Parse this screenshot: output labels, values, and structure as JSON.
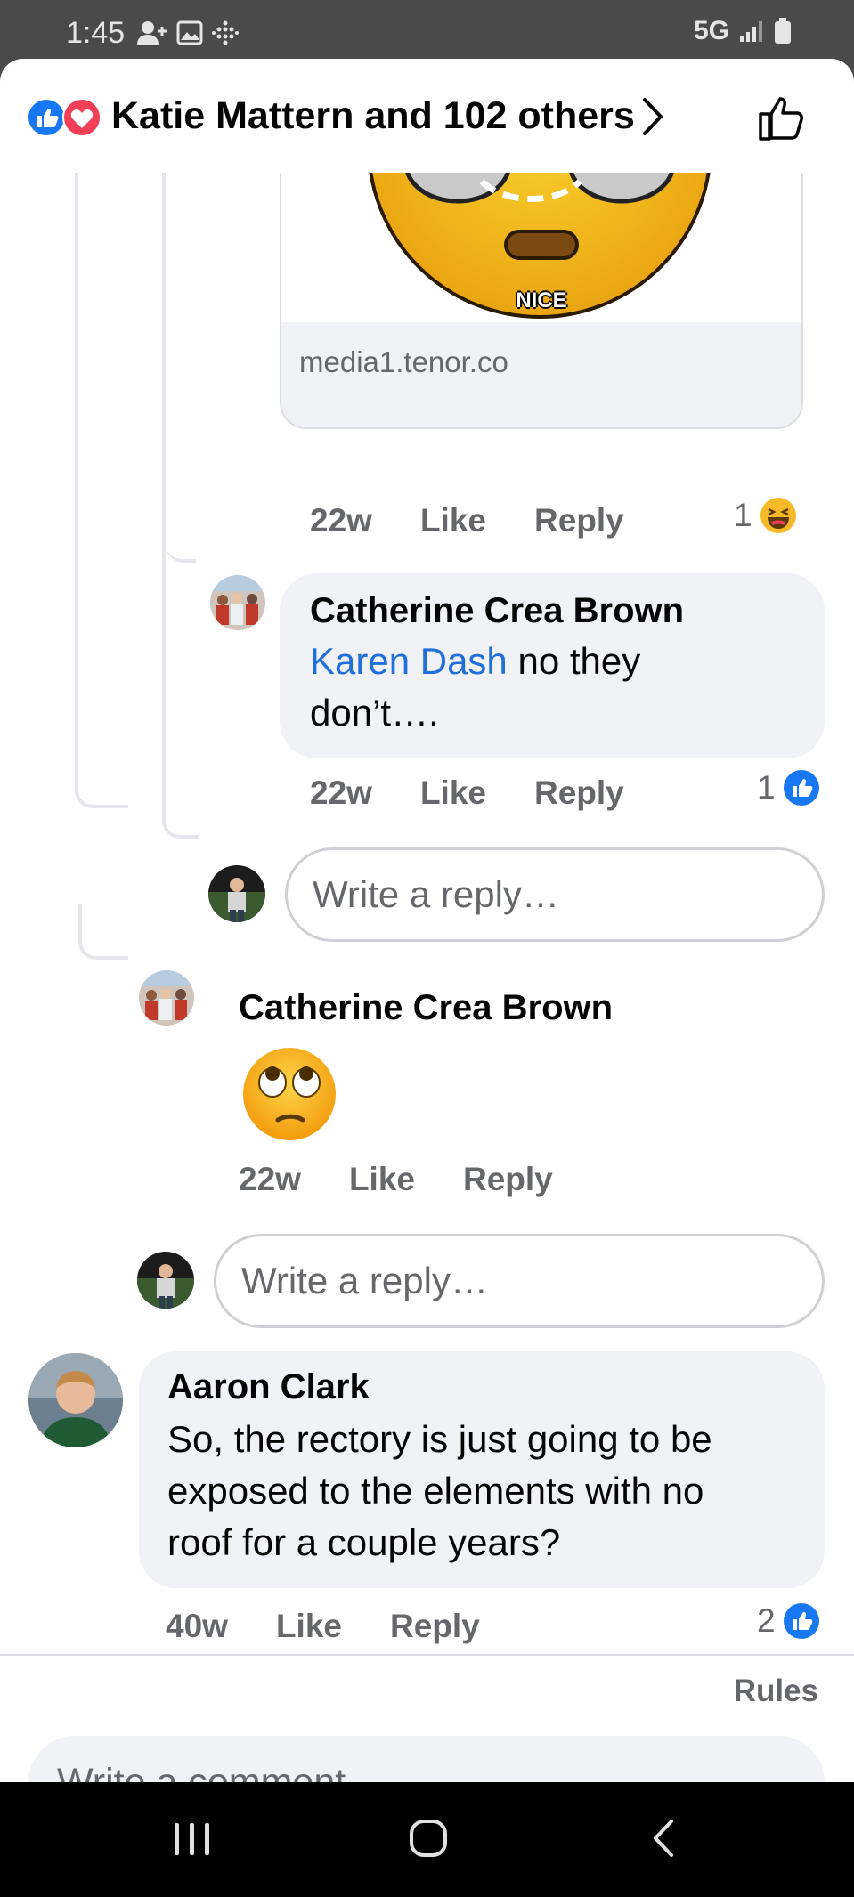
{
  "status_bar": {
    "time": "1:45",
    "network": "5G"
  },
  "header": {
    "title": "Katie Mattern and 102 others"
  },
  "link_card": {
    "overlay_text": "NICE",
    "domain": "media1.tenor.co"
  },
  "meta1": {
    "time": "22w",
    "like": "Like",
    "reply": "Reply",
    "count": "1"
  },
  "comment_catherine_1": {
    "author": "Catherine Crea Brown",
    "mention": "Karen Dash",
    "text_rest": " no they",
    "text_line2": "don’t….",
    "time": "22w",
    "like": "Like",
    "reply": "Reply",
    "count": "1"
  },
  "reply_box_1": {
    "placeholder": "Write a reply…"
  },
  "comment_catherine_2": {
    "author": "Catherine Crea Brown",
    "emoji": "🙄",
    "time": "22w",
    "like": "Like",
    "reply": "Reply"
  },
  "reply_box_2": {
    "placeholder": "Write a reply…"
  },
  "comment_aaron": {
    "author": "Aaron Clark",
    "line1": "So, the rectory is just going to be",
    "line2": "exposed to the elements with no",
    "line3": "roof for a couple years?",
    "time": "40w",
    "like": "Like",
    "reply": "Reply",
    "count": "2"
  },
  "footer": {
    "rules": "Rules",
    "comment_placeholder": "Write a comment…"
  },
  "colors": {
    "like_blue": "#1877f2",
    "love_red": "#f33e58",
    "link_blue": "#216fdb",
    "bubble_gray": "#f0f2f5"
  }
}
